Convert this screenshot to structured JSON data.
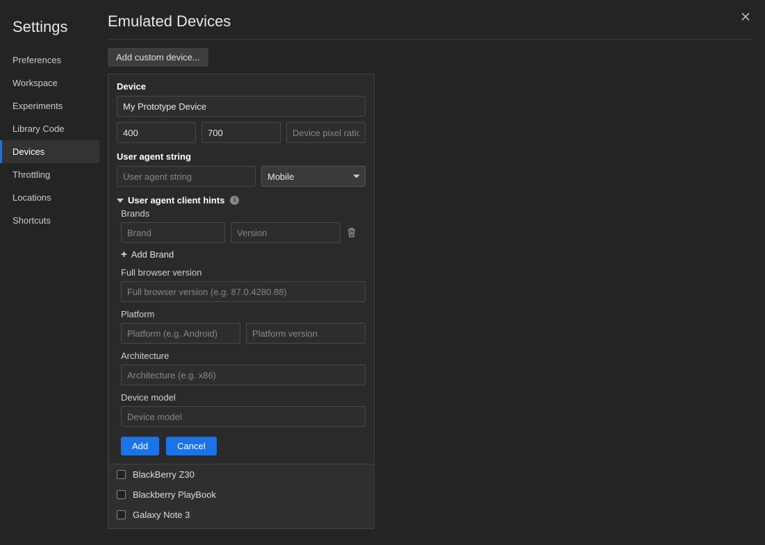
{
  "sidebar": {
    "title": "Settings",
    "items": [
      {
        "label": "Preferences"
      },
      {
        "label": "Workspace"
      },
      {
        "label": "Experiments"
      },
      {
        "label": "Library Code"
      },
      {
        "label": "Devices"
      },
      {
        "label": "Throttling"
      },
      {
        "label": "Locations"
      },
      {
        "label": "Shortcuts"
      }
    ],
    "selected_index": 4
  },
  "page": {
    "title": "Emulated Devices",
    "add_custom_label": "Add custom device..."
  },
  "form": {
    "device_label": "Device",
    "device_name": "My Prototype Device",
    "width": "400",
    "height": "700",
    "dpr_placeholder": "Device pixel ratio",
    "ua_label": "User agent string",
    "ua_placeholder": "User agent string",
    "ua_type_selected": "Mobile",
    "hints_label": "User agent client hints",
    "brands_label": "Brands",
    "brand_placeholder": "Brand",
    "version_placeholder": "Version",
    "add_brand_label": "Add Brand",
    "fbv_label": "Full browser version",
    "fbv_placeholder": "Full browser version (e.g. 87.0.4280.88)",
    "platform_label": "Platform",
    "platform_placeholder": "Platform (e.g. Android)",
    "platform_version_placeholder": "Platform version",
    "arch_label": "Architecture",
    "arch_placeholder": "Architecture (e.g. x86)",
    "model_label": "Device model",
    "model_placeholder": "Device model",
    "add_btn": "Add",
    "cancel_btn": "Cancel"
  },
  "device_list": [
    {
      "checked": false,
      "name": "BlackBerry Z30"
    },
    {
      "checked": false,
      "name": "Blackberry PlayBook"
    },
    {
      "checked": false,
      "name": "Galaxy Note 3"
    }
  ]
}
